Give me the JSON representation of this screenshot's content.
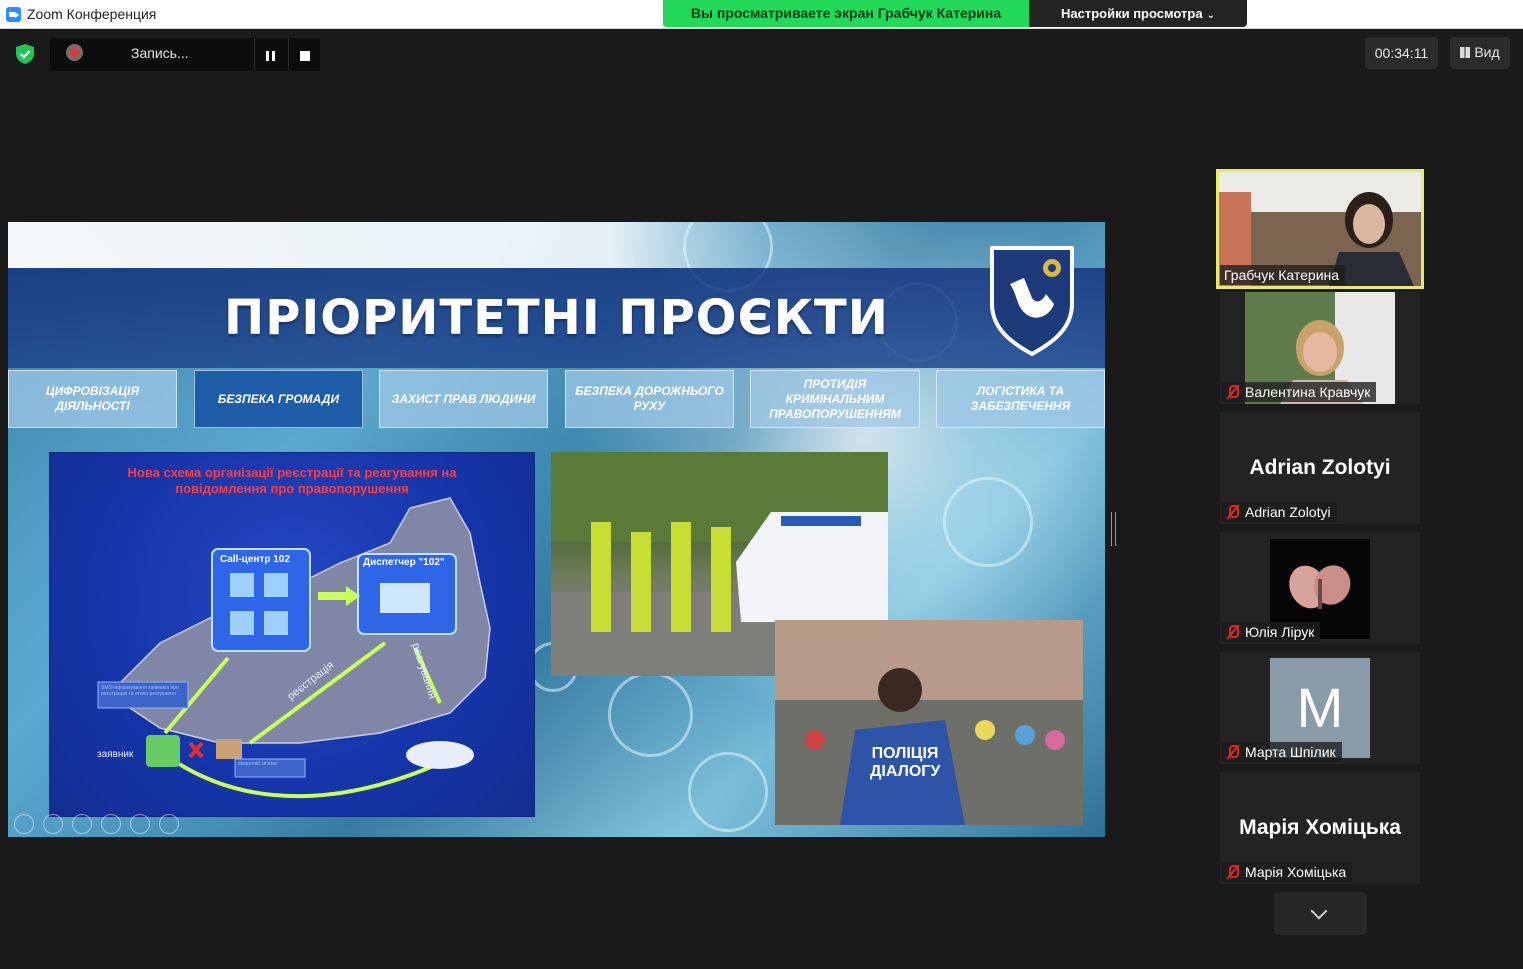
{
  "window": {
    "title": "Zoom Конференция"
  },
  "share": {
    "banner": "Вы просматриваете экран Грабчук Катерина",
    "view_settings": "Настройки просмотра"
  },
  "recording": {
    "label": "Запись..."
  },
  "meeting": {
    "timer": "00:34:11",
    "view_label": "Вид"
  },
  "slide": {
    "heading": "ПРІОРИТЕТНІ ПРОЄКТИ",
    "tabs": [
      "Цифровізація діяльності",
      "Безпека громади",
      "Захист прав людини",
      "Безпека дорожнього руху",
      "Протидія кримінальним правопорушенням",
      "Логістика та забезпечення"
    ],
    "active_tab": "Безпека громади",
    "diagram": {
      "title": "Нова схема організації реєстрації та реагування на повідомлення про правопорушення",
      "callcenter": "Call-центр 102",
      "dispatcher": "Диспетчер \"102\"",
      "registration": "реєстрація",
      "response": "реагування",
      "applicant": "заявник",
      "sms_note": "SMS-інформування заявника про реєстрацію та етапи реагування",
      "feedback_note": "зворотній зв'язок"
    },
    "photo_caption": "поліція діалогу"
  },
  "participants": [
    {
      "name": "Грабчук Катерина",
      "muted": false,
      "video": true
    },
    {
      "name": "Валентина Кравчук",
      "muted": true,
      "video": true
    },
    {
      "name": "Adrian Zolotyi",
      "display": "Adrian Zolotyi",
      "muted": true,
      "video": false
    },
    {
      "name": "Юлія Лірук",
      "muted": true,
      "video": true
    },
    {
      "name": "Марта Шпілик",
      "initial": "M",
      "muted": true,
      "video": false
    },
    {
      "name": "Марія Хоміцька",
      "display": "Марія Хоміцька",
      "muted": true,
      "video": false
    }
  ],
  "colors": {
    "share_banner": "#23d959",
    "active_speaker_border": "#e9e96b",
    "active_tab": "#1f5da8"
  }
}
